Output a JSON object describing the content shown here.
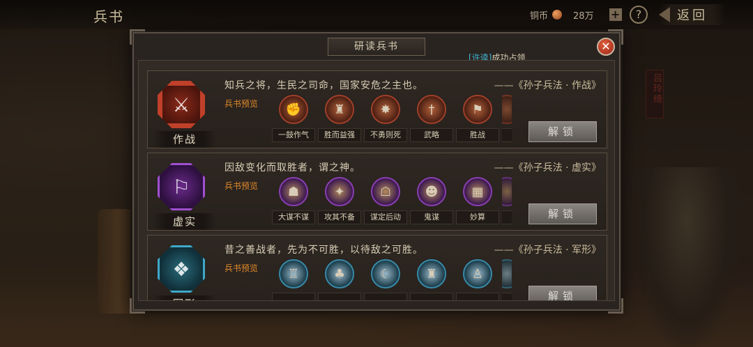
{
  "topbar": {
    "title": "兵书",
    "currency_label": "铜币",
    "currency_amount": "28万",
    "help_label": "?",
    "back_label": "返回"
  },
  "background": {
    "side_banner_text": "吕玲绮"
  },
  "modal": {
    "title": "研读兵书",
    "close_label": "✕",
    "notice_highlight": "[许逵]",
    "notice_text": "成功占领",
    "preview_label": "兵书预览",
    "unlock_label": "解锁"
  },
  "books": [
    {
      "name": "作战",
      "emblem_icon": "crossed-swords-icon",
      "quote": "知兵之将，生民之司命，国家安危之主也。",
      "source": "——《孙子兵法 · 作战》",
      "skills": [
        {
          "name": "一鼓作气",
          "icon": "war-drum-icon"
        },
        {
          "name": "胜而益强",
          "icon": "warrior-icon"
        },
        {
          "name": "不勇则死",
          "icon": "charge-icon"
        },
        {
          "name": "武略",
          "icon": "sword-icon"
        },
        {
          "name": "胜战",
          "icon": "banner-icon"
        }
      ]
    },
    {
      "name": "虚实",
      "emblem_icon": "flag-icon",
      "quote": "因敌变化而取胜者，谓之神。",
      "source": "——《孙子兵法 · 虚实》",
      "skills": [
        {
          "name": "大谋不谋",
          "icon": "strategist-icon"
        },
        {
          "name": "攻其不备",
          "icon": "ambush-icon"
        },
        {
          "name": "谋定后动",
          "icon": "plan-icon"
        },
        {
          "name": "鬼谋",
          "icon": "mask-icon"
        },
        {
          "name": "妙算",
          "icon": "abacus-icon"
        }
      ]
    },
    {
      "name": "军形",
      "emblem_icon": "formation-icon",
      "quote": "昔之善战者，先为不可胜，以待敌之可胜。",
      "source": "——《孙子兵法 · 军形》",
      "skills": [
        {
          "name": "",
          "icon": "fortress-icon"
        },
        {
          "name": "",
          "icon": "tree-icon"
        },
        {
          "name": "",
          "icon": "crescent-icon"
        },
        {
          "name": "",
          "icon": "tower-icon"
        },
        {
          "name": "",
          "icon": "sage-icon"
        }
      ]
    }
  ]
}
